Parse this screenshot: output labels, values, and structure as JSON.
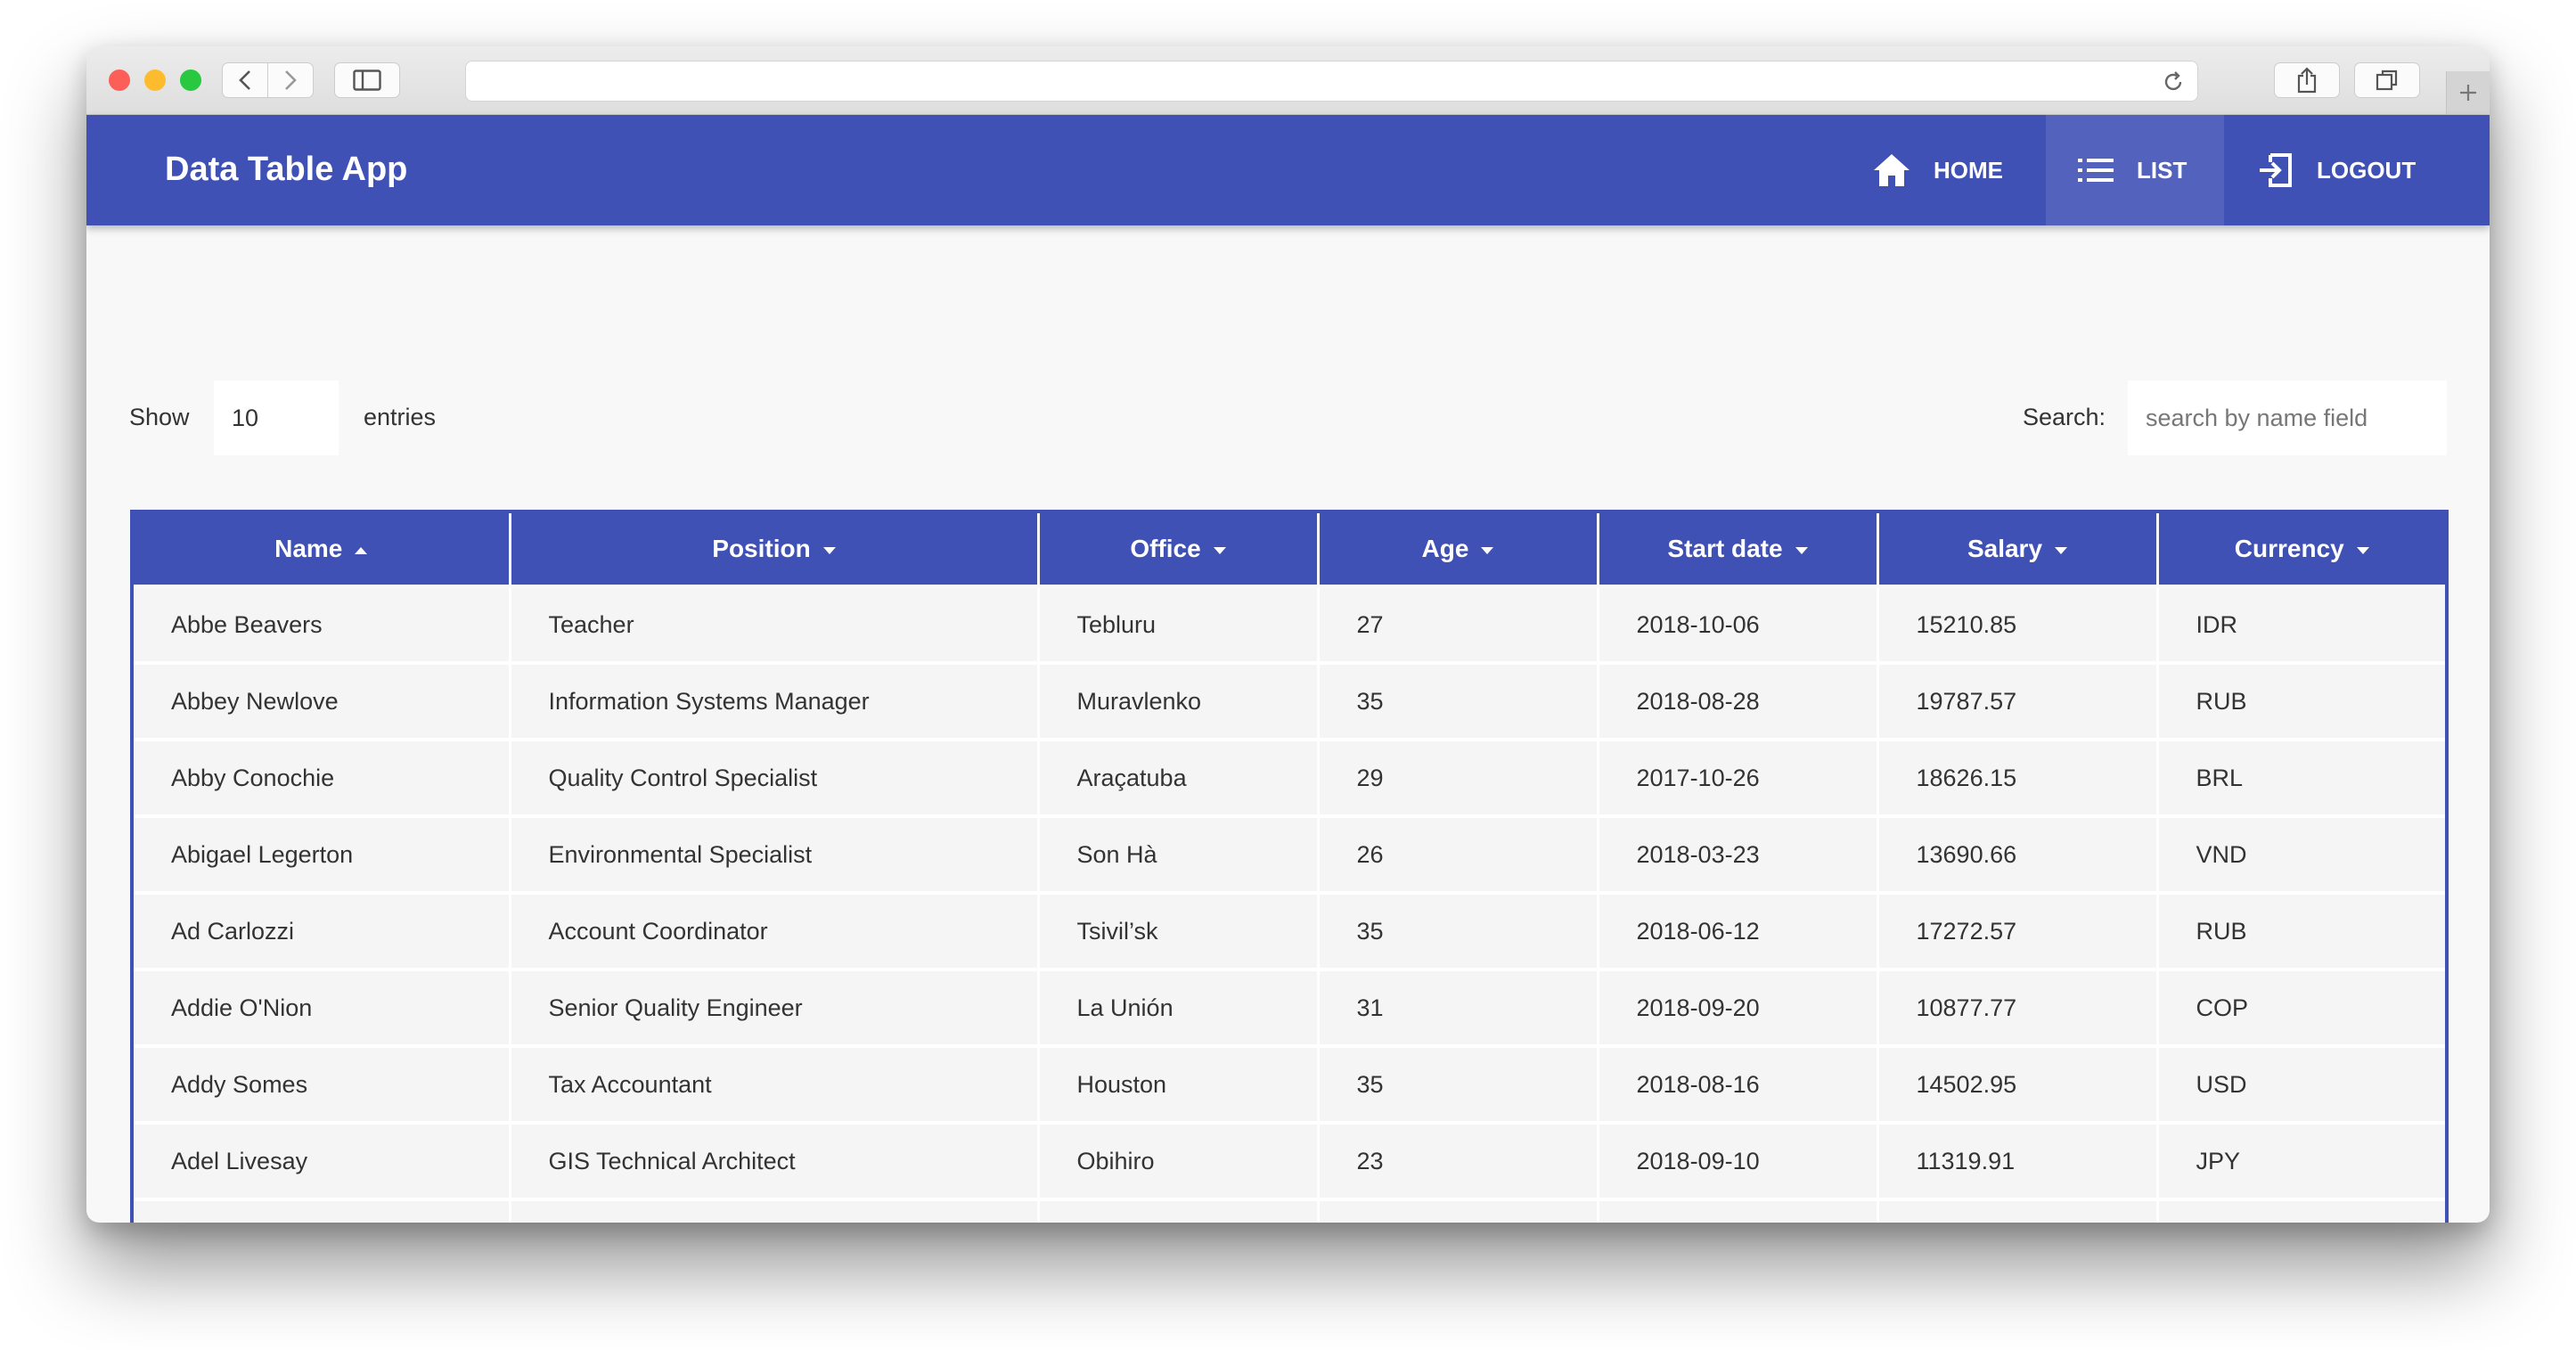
{
  "app": {
    "title": "Data Table App",
    "nav": [
      {
        "label": "HOME",
        "icon": "home-icon",
        "active": false
      },
      {
        "label": "LIST",
        "icon": "list-icon",
        "active": true
      },
      {
        "label": "LOGOUT",
        "icon": "logout-icon",
        "active": false
      }
    ],
    "accent": "#3f51b5"
  },
  "controls": {
    "show_label": "Show",
    "page_length": "10",
    "entries_label": "entries",
    "search_label": "Search:",
    "search_placeholder": "search by name field",
    "search_value": ""
  },
  "table": {
    "columns": [
      {
        "label": "Name",
        "sort": "asc"
      },
      {
        "label": "Position",
        "sort": "none"
      },
      {
        "label": "Office",
        "sort": "none"
      },
      {
        "label": "Age",
        "sort": "none"
      },
      {
        "label": "Start date",
        "sort": "none"
      },
      {
        "label": "Salary",
        "sort": "none"
      },
      {
        "label": "Currency",
        "sort": "none"
      }
    ],
    "rows": [
      [
        "Abbe Beavers",
        "Teacher",
        "Tebluru",
        "27",
        "2018-10-06",
        "15210.85",
        "IDR"
      ],
      [
        "Abbey Newlove",
        "Information Systems Manager",
        "Muravlenko",
        "35",
        "2018-08-28",
        "19787.57",
        "RUB"
      ],
      [
        "Abby Conochie",
        "Quality Control Specialist",
        "Araçatuba",
        "29",
        "2017-10-26",
        "18626.15",
        "BRL"
      ],
      [
        "Abigael Legerton",
        "Environmental Specialist",
        "Son Hà",
        "26",
        "2018-03-23",
        "13690.66",
        "VND"
      ],
      [
        "Ad Carlozzi",
        "Account Coordinator",
        "Tsivil’sk",
        "35",
        "2018-06-12",
        "17272.57",
        "RUB"
      ],
      [
        "Addie O'Nion",
        "Senior Quality Engineer",
        "La Unión",
        "31",
        "2018-09-20",
        "10877.77",
        "COP"
      ],
      [
        "Addy Somes",
        "Tax Accountant",
        "Houston",
        "35",
        "2018-08-16",
        "14502.95",
        "USD"
      ],
      [
        "Adel Livesay",
        "GIS Technical Architect",
        "Obihiro",
        "23",
        "2018-09-10",
        "11319.91",
        "JPY"
      ],
      [
        "",
        "",
        "",
        "",
        "",
        "",
        ""
      ]
    ]
  }
}
